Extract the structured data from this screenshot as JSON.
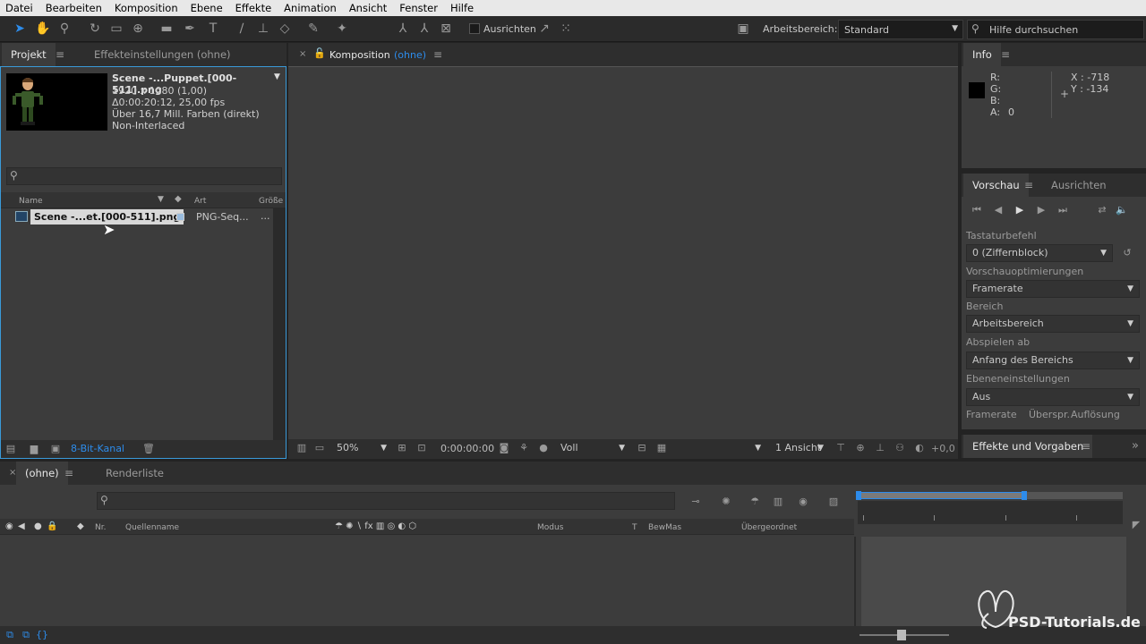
{
  "menubar": [
    "Datei",
    "Bearbeiten",
    "Komposition",
    "Ebene",
    "Effekte",
    "Animation",
    "Ansicht",
    "Fenster",
    "Hilfe"
  ],
  "toolbar": {
    "align_label": "Ausrichten",
    "workspace_label": "Arbeitsbereich:",
    "workspace_value": "Standard",
    "help_placeholder": "Hilfe durchsuchen"
  },
  "project_panel": {
    "tab_project": "Projekt",
    "tab_effects": "Effekteinstellungen (ohne)",
    "file_name": "Scene -...Puppet.[000-511].png",
    "resolution": "1920 x 1080 (1,00)",
    "duration": "Δ0:00:20:12, 25,00 fps",
    "colors": "Über 16,7 Mill. Farben (direkt)",
    "interlace": "Non-Interlaced",
    "col_name": "Name",
    "col_type": "Art",
    "col_size": "Größe",
    "item_name": "Scene -...et.[000-511].png",
    "item_type": "PNG-Seq...",
    "item_size": "...",
    "bit_depth": "8-Bit-Kanal"
  },
  "comp_panel": {
    "tab_prefix": "Komposition",
    "tab_name": "(ohne)",
    "zoom": "50%",
    "timecode": "0:00:00:00",
    "quality": "Voll",
    "views": "1 Ansicht",
    "exposure": "+0,0"
  },
  "info_panel": {
    "title": "Info",
    "r": "R:",
    "g": "G:",
    "b": "B:",
    "a": "A:",
    "a_val": "0",
    "x": "X : -718",
    "y": "Y : -134"
  },
  "preview_panel": {
    "tab_preview": "Vorschau",
    "tab_align": "Ausrichten",
    "shortcut_label": "Tastaturbefehl",
    "shortcut_value": "0 (Ziffernblock)",
    "optimize_label": "Vorschauoptimierungen",
    "optimize_value": "Framerate",
    "range_label": "Bereich",
    "range_value": "Arbeitsbereich",
    "play_from_label": "Abspielen ab",
    "play_from_value": "Anfang des Bereichs",
    "layer_settings_label": "Ebeneneinstellungen",
    "layer_settings_value": "Aus",
    "framerate_label": "Framerate",
    "skip_label": "Überspr.",
    "resolution_label": "Auflösung"
  },
  "effects_panel": {
    "title": "Effekte und Vorgaben"
  },
  "timeline": {
    "tab_comp": "(ohne)",
    "tab_render": "Renderliste",
    "col_nr": "Nr.",
    "col_source": "Quellenname",
    "col_mode": "Modus",
    "col_t": "T",
    "col_trkmat": "BewMas",
    "col_parent": "Übergeordnet"
  },
  "watermark": "PSD-Tutorials.de",
  "colors": {
    "accent": "#2d8ceb",
    "panel": "#3c3c3c",
    "dark": "#232323",
    "selected_border": "#3a9ad9"
  }
}
